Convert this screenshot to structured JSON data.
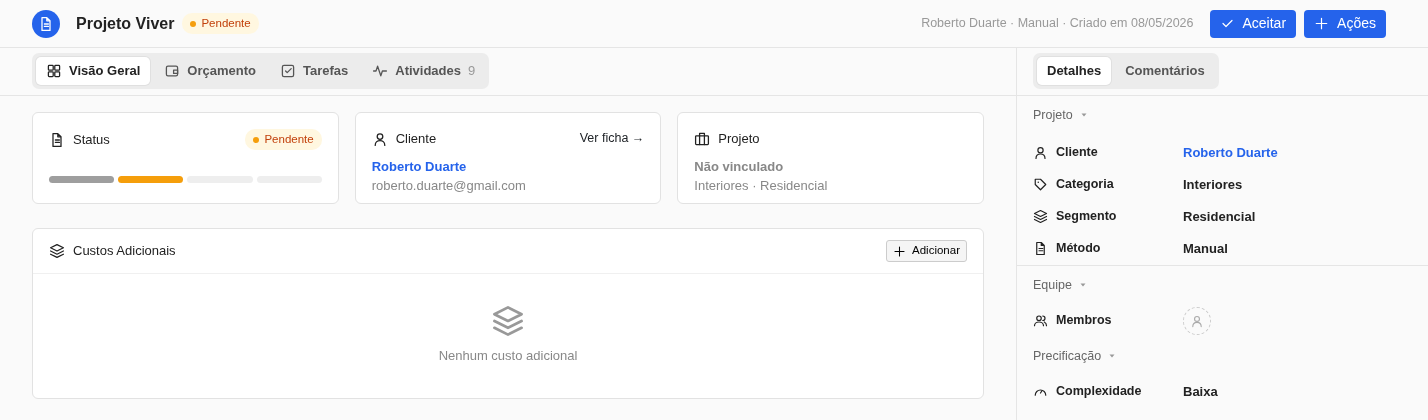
{
  "header": {
    "title": "Projeto Viver",
    "status": "Pendente",
    "meta": "Roberto Duarte · Manual · Criado em 08/05/2026",
    "buttons": [
      {
        "label": "Aceitar",
        "kind": "check"
      },
      {
        "label": "Ações",
        "kind": "plus"
      }
    ]
  },
  "tabs": [
    {
      "label": "Visão Geral",
      "selected": true
    },
    {
      "label": "Orçamento",
      "selected": false
    },
    {
      "label": "Tarefas",
      "selected": false
    },
    {
      "label": "Atividades",
      "count": "9",
      "selected": false
    }
  ],
  "cards": [
    {
      "kind": "status",
      "title": "Status",
      "badge": "Pendente",
      "steps": [
        {
          "kind": "done"
        },
        {
          "kind": "current"
        },
        {
          "kind": "pending"
        },
        {
          "kind": "pending"
        }
      ]
    },
    {
      "kind": "client",
      "title": "Cliente",
      "link": "Ver ficha →",
      "name": "Roberto Duarte",
      "email": "roberto.duarte@gmail.com"
    },
    {
      "kind": "project",
      "title": "Projeto",
      "name": "Não vinculado",
      "detail": "Interiores · Residencial"
    }
  ],
  "extra_costs": {
    "title": "Custos Adicionais",
    "button": "Adicionar",
    "empty": "Nenhum custo adicional"
  },
  "side_tabs": [
    {
      "label": "Detalhes",
      "selected": true
    },
    {
      "label": "Comentários",
      "selected": false
    }
  ],
  "sections": [
    {
      "title": "Projeto",
      "rows": [
        {
          "label": "Cliente",
          "value": "Roberto Duarte",
          "kind": "link"
        },
        {
          "label": "Categoria",
          "value": "Interiores",
          "kind": "text"
        },
        {
          "label": "Segmento",
          "value": "Residencial",
          "kind": "text"
        },
        {
          "label": "Método",
          "value": "Manual",
          "kind": "text"
        }
      ]
    },
    {
      "title": "Equipe",
      "rows": [
        {
          "label": "Membros",
          "kind": "avatar"
        }
      ]
    },
    {
      "title": "Precificação",
      "rows": [
        {
          "label": "Complexidade",
          "value": "Baixa",
          "kind": "text"
        }
      ]
    }
  ]
}
